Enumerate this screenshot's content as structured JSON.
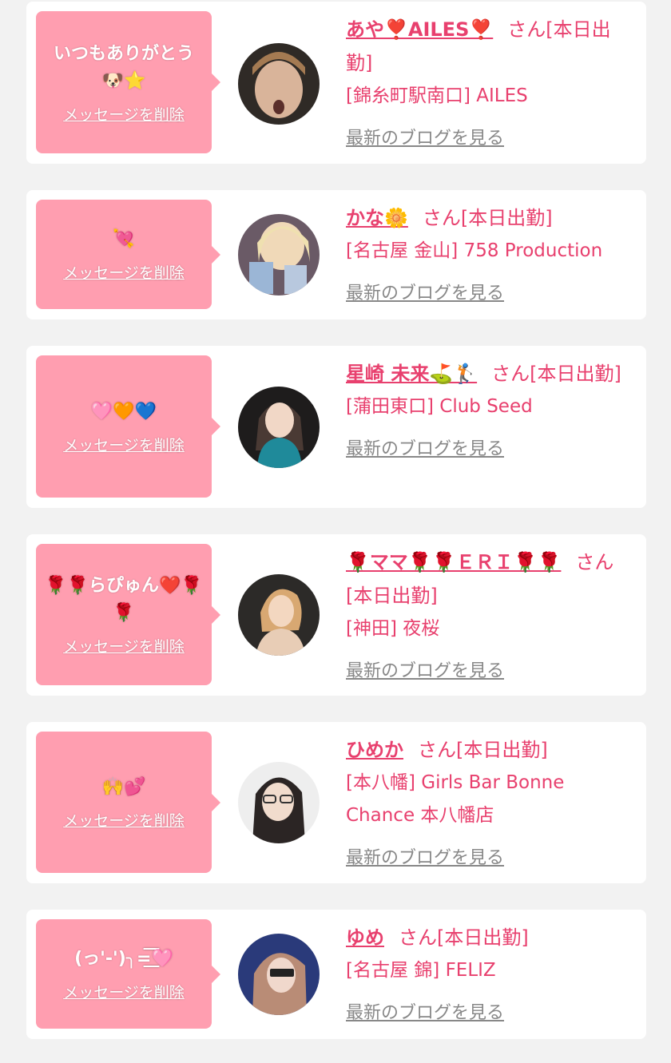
{
  "common": {
    "delete_label": "メッセージを削除",
    "blog_label": "最新のブログを見る",
    "status_suffix": "さん[本日出勤]"
  },
  "colors": {
    "page_bg": "#f2f2f2",
    "card_bg": "#ffffff",
    "bubble_bg": "#ff9eb0",
    "name_pink": "#e8406e",
    "blog_gray": "#888888"
  },
  "entries": [
    {
      "message": "いつもありがとう🐶⭐",
      "name": "あや❣️AILES❣️",
      "shop": "[錦糸町駅南口] AILES"
    },
    {
      "message": "💘",
      "name": "かな🌼",
      "shop": "[名古屋 金山] 758 Production"
    },
    {
      "message": "🩷🧡💙",
      "name": "星崎 未来⛳🏌️",
      "shop": "[蒲田東口] Club Seed"
    },
    {
      "message": "🌹🌹らぴゅん❤️🌹🌹",
      "name": "🌹ママ🌹🌹ＥＲＩ🌹🌹",
      "shop": "[神田] 夜桜"
    },
    {
      "message": "🙌💕",
      "name": "ひめか",
      "shop": "[本八幡] Girls Bar Bonne Chance 本八幡店"
    },
    {
      "message": "(っ'-')╮=͟͟͞͞🩷",
      "name": "ゆめ",
      "shop": "[名古屋 錦] FELIZ"
    }
  ]
}
